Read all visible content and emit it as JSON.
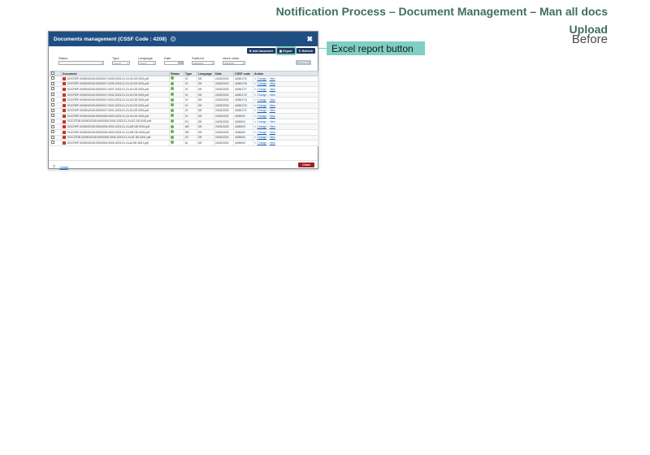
{
  "slide": {
    "title": "Notification Process – Document Management – Man all docs",
    "subtitle_line1": "Upload",
    "subtitle_line2": "Before"
  },
  "dialog": {
    "title": "Documents management (CSSF Code : 4208)",
    "close_glyph": "✖"
  },
  "toolbar": {
    "add_label": "Add document",
    "export_label": "Export",
    "refresh_label": "Refresh"
  },
  "filters": {
    "status_label": "Status",
    "type_label": "Type",
    "type_value": "(none)",
    "language_label": "Language",
    "language_value": "(none)",
    "date_label": "Date",
    "subfund_label": "Subfund",
    "subfund_value": "(Multiple)",
    "share_class_label": "share class",
    "share_class_value": "(Multiple)",
    "reset_label": "Reset"
  },
  "table": {
    "headers": [
      "",
      "Document",
      "Status",
      "Type",
      "Language",
      "Date",
      "CSSF code",
      "Action"
    ],
    "rows": [
      {
        "document": "DOCREP-0000042049-00000017-0005-2023-01-24-IO-DE-0001.pdf",
        "type": "IO",
        "language": "DE",
        "date": "24/02/2023",
        "code": "4208/17/5"
      },
      {
        "document": "DOCREP-0000042049-00000017-0006-2023-01-24-IO-DE-0001.pdf",
        "type": "IO",
        "language": "DE",
        "date": "24/02/2023",
        "code": "4208/17/6"
      },
      {
        "document": "DOCREP-0000042049-00000017-0007-2023-01-24-IO-DE-0001.pdf",
        "type": "IO",
        "language": "DE",
        "date": "24/02/2023",
        "code": "4208/17/7"
      },
      {
        "document": "DOCREP-0000042049-00000017-0002-2023-01-24-IO-DE-0001.pdf",
        "type": "IO",
        "language": "DE",
        "date": "24/02/2023",
        "code": "4208/17/2"
      },
      {
        "document": "DOCREP-0000042049-00000017-0004-2023-01-24-IO-DE-0001.pdf",
        "type": "IO",
        "language": "DE",
        "date": "24/02/2023",
        "code": "4208/17/4"
      },
      {
        "document": "DOCREP-0000042049-00000017-0003-2023-01-24-IO-DE-0001.pdf",
        "type": "IO",
        "language": "DE",
        "date": "24/02/2023",
        "code": "4208/17/3"
      },
      {
        "document": "DOCREP-0000042049-00000017-0001-2023-01-24-IO-DE-0001.pdf",
        "type": "IO",
        "language": "DE",
        "date": "24/02/2023",
        "code": "4208/17/1"
      },
      {
        "document": "DOCREP-0000042049-00000000-0000-2023-01-24-IO-DE-0001.pdf",
        "type": "IO",
        "language": "DE",
        "date": "24/02/2023",
        "code": "4208/0/0"
      },
      {
        "document": "DOCSTDB-0000042049-00000000-0000-2023-01-24-EC-DE-0001.pdf",
        "type": "EC",
        "language": "DE",
        "date": "24/02/2023",
        "code": "4208/0/0"
      },
      {
        "document": "DOCREP-0000042049-00000000-0000-2023-01-24-AR-DE-0001.pdf",
        "type": "AR",
        "language": "DE",
        "date": "24/02/2023",
        "code": "4208/0/0"
      },
      {
        "document": "DOCREP-0000042049-00000000-0000-2023-01-24-SR-DE-0001.pdf",
        "type": "SR",
        "language": "DE",
        "date": "24/02/2023",
        "code": "4208/0/0"
      },
      {
        "document": "DOCSTDB-0000042049-00000000-0000-2023-01-24-AT-DE-0001.pdf",
        "type": "AT",
        "language": "DE",
        "date": "24/02/2023",
        "code": "4208/0/0"
      },
      {
        "document": "DOCREP-0000042049-00000000-0000-2023-01-24-AI-DE-0001.pdf",
        "type": "AI",
        "language": "DE",
        "date": "24/02/2023",
        "code": "4208/0/0"
      }
    ],
    "action_change": "Change",
    "action_view": "View"
  },
  "footer": {
    "link_label": "Cancel",
    "close_label": "Close"
  },
  "callout": {
    "label": "Excel report button"
  },
  "colors": {
    "header_bg": "#1f4f82",
    "accent_callout": "#7fcfc2",
    "close_button": "#a41d23",
    "title_green": "#3e6f63"
  }
}
